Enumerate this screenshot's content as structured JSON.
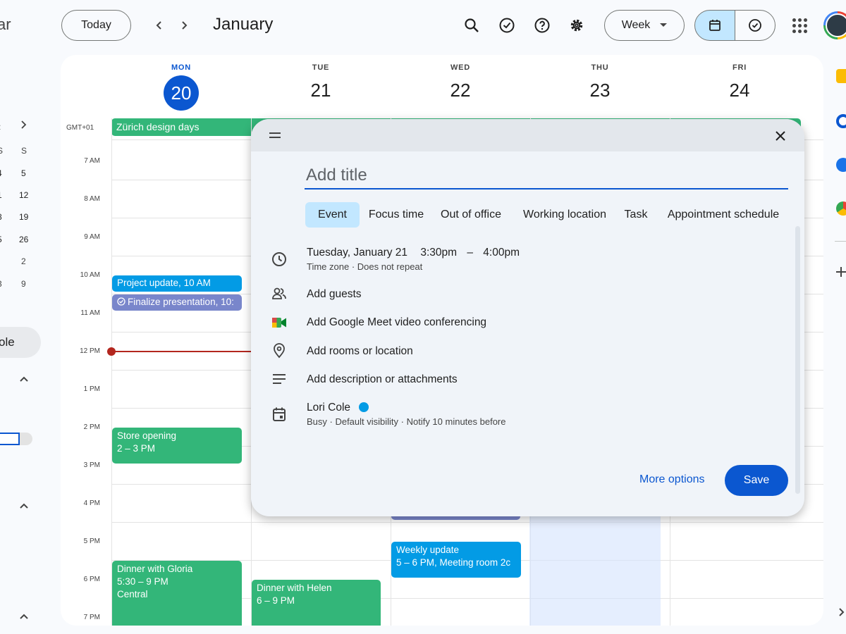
{
  "header": {
    "app_title_fragment": "ar",
    "today_label": "Today",
    "month_title": "January",
    "view_label": "Week"
  },
  "mini_calendar": {
    "rows": [
      [
        "S",
        "S"
      ],
      [
        "4",
        "5"
      ],
      [
        "1",
        "12"
      ],
      [
        "8",
        "19"
      ],
      [
        "5",
        "26"
      ],
      [
        "",
        "2"
      ],
      [
        "3",
        "9"
      ]
    ]
  },
  "sidebar": {
    "my_calendar_fragment": "ole"
  },
  "calendar": {
    "timezone": "GMT+01",
    "days": [
      {
        "dow": "MON",
        "num": "20"
      },
      {
        "dow": "TUE",
        "num": "21"
      },
      {
        "dow": "WED",
        "num": "22"
      },
      {
        "dow": "THU",
        "num": "23"
      },
      {
        "dow": "FRI",
        "num": "24"
      }
    ],
    "times": [
      "7 AM",
      "8 AM",
      "9 AM",
      "10 AM",
      "11 AM",
      "12 PM",
      "1 PM",
      "2 PM",
      "3 PM",
      "4 PM",
      "5 PM",
      "6 PM",
      "7 PM"
    ],
    "allday_event": "Zürich design days",
    "events": {
      "project_update": {
        "title": "Project update,",
        "time": "10 AM"
      },
      "finalize": {
        "title": "Finalize presentation, 10:"
      },
      "store_opening": {
        "title": "Store opening",
        "time": "2 – 3 PM"
      },
      "weekly_update": {
        "title": "Weekly update",
        "time": "5 – 6 PM, Meeting room 2c"
      },
      "dinner_gloria": {
        "title": "Dinner with Gloria",
        "time": "5:30 – 9 PM",
        "location": "Central"
      },
      "dinner_helen": {
        "title": "Dinner with Helen",
        "time": "6 – 9 PM"
      }
    }
  },
  "dialog": {
    "title_placeholder": "Add title",
    "tabs": [
      "Event",
      "Focus time",
      "Out of office",
      "Working location",
      "Task",
      "Appointment schedule"
    ],
    "date": "Tuesday, January 21",
    "start_time": "3:30pm",
    "dash": "–",
    "end_time": "4:00pm",
    "time_sub": "Time zone · Does not repeat",
    "add_guests": "Add guests",
    "meet": "Add Google Meet video conferencing",
    "location": "Add rooms or location",
    "description": "Add description or attachments",
    "calendar_owner": "Lori Cole",
    "calendar_sub": "Busy · Default visibility · Notify 10 minutes before",
    "more_options": "More options",
    "save": "Save"
  },
  "colors": {
    "accent": "#0b57d0",
    "event_blue": "#039be5",
    "event_purple": "#7986cb",
    "event_green": "#33b679",
    "now_line": "#b3261e"
  }
}
